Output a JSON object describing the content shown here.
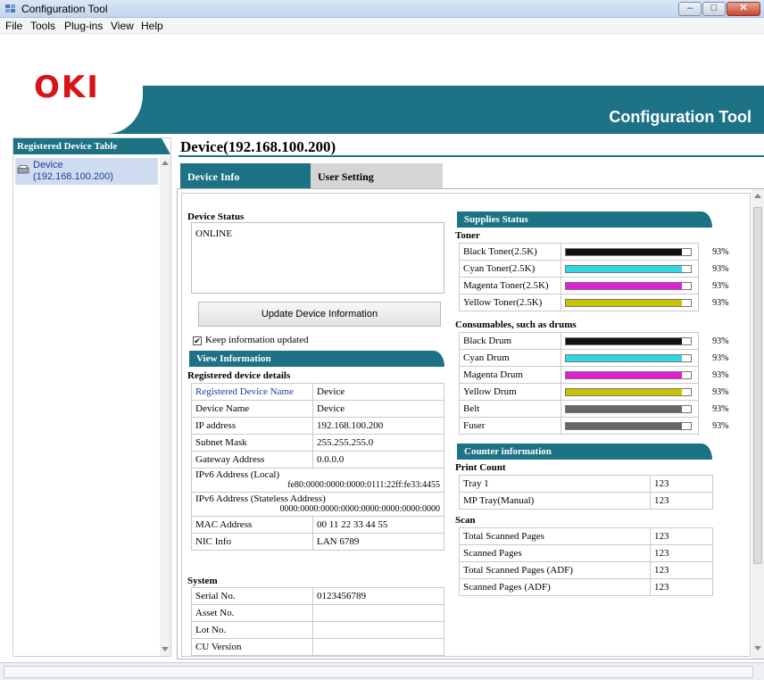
{
  "window": {
    "title": "Configuration Tool"
  },
  "menu": [
    "File",
    "Tools",
    "Plug-ins",
    "View",
    "Help"
  ],
  "banner": {
    "logo": "OKI",
    "title": "Configuration Tool"
  },
  "sidebar": {
    "header": "Registered Device Table",
    "items": [
      {
        "name": "Device",
        "address": "(192.168.100.200)"
      }
    ]
  },
  "main": {
    "device_title": "Device(192.168.100.200)",
    "tabs": [
      {
        "label": "Device Info",
        "active": true
      },
      {
        "label": "User Setting",
        "active": false
      }
    ]
  },
  "device_status": {
    "label": "Device Status",
    "value": "ONLINE",
    "update_button": "Update Device Information",
    "keep_updated_label": "Keep information updated",
    "keep_updated_checked": true,
    "check_mark": "✔"
  },
  "view_info": {
    "header": "View Information",
    "details_label": "Registered device details",
    "details": [
      {
        "key": "Registered Device Name",
        "value": "Device"
      },
      {
        "key": "Device Name",
        "value": "Device"
      },
      {
        "key": "IP address",
        "value": "192.168.100.200"
      },
      {
        "key": "Subnet Mask",
        "value": "255.255.255.0"
      },
      {
        "key": "Gateway Address",
        "value": "0.0.0.0"
      }
    ],
    "ipv6_local": {
      "key": "IPv6 Address (Local)",
      "value": "fe80:0000:0000:0000:0111:22ff:fe33:4455"
    },
    "ipv6_stateless": {
      "key": "IPv6 Address (Stateless Address)",
      "value": "0000:0000:0000:0000:0000:0000:0000:0000"
    },
    "details_tail": [
      {
        "key": "MAC Address",
        "value": "00 11 22 33 44 55"
      },
      {
        "key": "NIC Info",
        "value": "LAN 6789"
      }
    ],
    "system_label": "System",
    "system": [
      {
        "key": "Serial No.",
        "value": "0123456789"
      },
      {
        "key": "Asset No.",
        "value": ""
      },
      {
        "key": "Lot No.",
        "value": ""
      },
      {
        "key": "CU Version",
        "value": ""
      }
    ]
  },
  "supplies": {
    "header": "Supplies Status",
    "toner_label": "Toner",
    "toner": [
      {
        "name": "Black Toner(2.5K)",
        "percent": "93%",
        "level": 0.93,
        "color": "#111111"
      },
      {
        "name": "Cyan Toner(2.5K)",
        "percent": "93%",
        "level": 0.93,
        "color": "#2fd6e0"
      },
      {
        "name": "Magenta Toner(2.5K)",
        "percent": "93%",
        "level": 0.93,
        "color": "#e01fd2"
      },
      {
        "name": "Yellow Toner(2.5K)",
        "percent": "93%",
        "level": 0.93,
        "color": "#c9c400"
      }
    ],
    "consumables_label": "Consumables, such as drums",
    "consumables": [
      {
        "name": "Black Drum",
        "percent": "93%",
        "level": 0.93,
        "color": "#111111"
      },
      {
        "name": "Cyan Drum",
        "percent": "93%",
        "level": 0.93,
        "color": "#2fd6e0"
      },
      {
        "name": "Magenta Drum",
        "percent": "93%",
        "level": 0.93,
        "color": "#e01fd2"
      },
      {
        "name": "Yellow Drum",
        "percent": "93%",
        "level": 0.93,
        "color": "#c9c400"
      },
      {
        "name": "Belt",
        "percent": "93%",
        "level": 0.93,
        "color": "#666666"
      },
      {
        "name": "Fuser",
        "percent": "93%",
        "level": 0.93,
        "color": "#666666"
      }
    ]
  },
  "counter": {
    "header": "Counter information",
    "print_label": "Print Count",
    "print": [
      {
        "key": "Tray 1",
        "value": "123"
      },
      {
        "key": "MP Tray(Manual)",
        "value": "123"
      }
    ],
    "scan_label": "Scan",
    "scan": [
      {
        "key": "Total Scanned Pages",
        "value": "123"
      },
      {
        "key": "Scanned Pages",
        "value": "123"
      },
      {
        "key": "Total Scanned Pages (ADF)",
        "value": "123"
      },
      {
        "key": "Scanned Pages (ADF)",
        "value": "123"
      }
    ]
  },
  "colors": {
    "accent": "#1d7286",
    "logo": "#d8141b",
    "link": "#1a3d9a"
  }
}
